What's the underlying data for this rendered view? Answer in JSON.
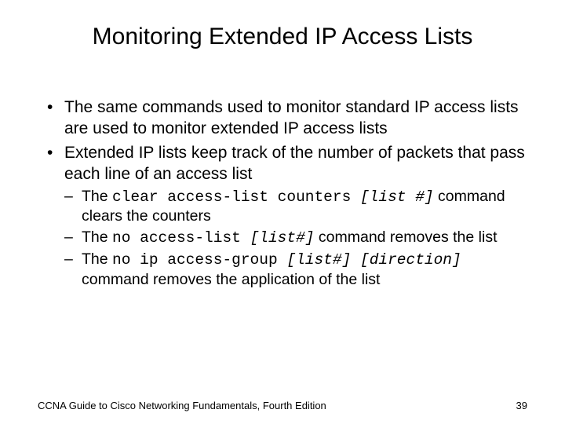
{
  "title": "Monitoring Extended IP Access Lists",
  "bullets": {
    "b1": "The same commands used to monitor standard IP access lists are used to monitor extended IP access lists",
    "b2": "Extended IP lists keep track of the number of packets that pass each line of an access list",
    "s1_pre": "The ",
    "s1_cmd": "clear access-list counters ",
    "s1_arg": "[list #]",
    "s1_post": " command clears the counters",
    "s2_pre": "The ",
    "s2_cmd": "no access-list ",
    "s2_arg": "[list#]",
    "s2_post": " command removes the list",
    "s3_pre": "The ",
    "s3_cmd": "no ip access-group ",
    "s3_arg": "[list#] [direction]",
    "s3_post": " command removes the application of the list"
  },
  "footer": {
    "left": "CCNA Guide to Cisco Networking Fundamentals, Fourth Edition",
    "right": "39"
  }
}
